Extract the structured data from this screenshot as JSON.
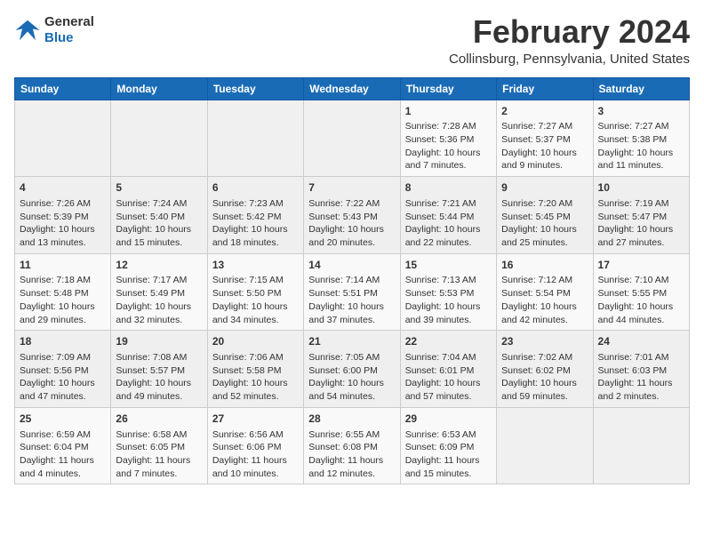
{
  "header": {
    "logo_line1": "General",
    "logo_line2": "Blue",
    "month_title": "February 2024",
    "location": "Collinsburg, Pennsylvania, United States"
  },
  "days_of_week": [
    "Sunday",
    "Monday",
    "Tuesday",
    "Wednesday",
    "Thursday",
    "Friday",
    "Saturday"
  ],
  "weeks": [
    [
      {
        "day": "",
        "content": ""
      },
      {
        "day": "",
        "content": ""
      },
      {
        "day": "",
        "content": ""
      },
      {
        "day": "",
        "content": ""
      },
      {
        "day": "1",
        "content": "Sunrise: 7:28 AM\nSunset: 5:36 PM\nDaylight: 10 hours\nand 7 minutes."
      },
      {
        "day": "2",
        "content": "Sunrise: 7:27 AM\nSunset: 5:37 PM\nDaylight: 10 hours\nand 9 minutes."
      },
      {
        "day": "3",
        "content": "Sunrise: 7:27 AM\nSunset: 5:38 PM\nDaylight: 10 hours\nand 11 minutes."
      }
    ],
    [
      {
        "day": "4",
        "content": "Sunrise: 7:26 AM\nSunset: 5:39 PM\nDaylight: 10 hours\nand 13 minutes."
      },
      {
        "day": "5",
        "content": "Sunrise: 7:24 AM\nSunset: 5:40 PM\nDaylight: 10 hours\nand 15 minutes."
      },
      {
        "day": "6",
        "content": "Sunrise: 7:23 AM\nSunset: 5:42 PM\nDaylight: 10 hours\nand 18 minutes."
      },
      {
        "day": "7",
        "content": "Sunrise: 7:22 AM\nSunset: 5:43 PM\nDaylight: 10 hours\nand 20 minutes."
      },
      {
        "day": "8",
        "content": "Sunrise: 7:21 AM\nSunset: 5:44 PM\nDaylight: 10 hours\nand 22 minutes."
      },
      {
        "day": "9",
        "content": "Sunrise: 7:20 AM\nSunset: 5:45 PM\nDaylight: 10 hours\nand 25 minutes."
      },
      {
        "day": "10",
        "content": "Sunrise: 7:19 AM\nSunset: 5:47 PM\nDaylight: 10 hours\nand 27 minutes."
      }
    ],
    [
      {
        "day": "11",
        "content": "Sunrise: 7:18 AM\nSunset: 5:48 PM\nDaylight: 10 hours\nand 29 minutes."
      },
      {
        "day": "12",
        "content": "Sunrise: 7:17 AM\nSunset: 5:49 PM\nDaylight: 10 hours\nand 32 minutes."
      },
      {
        "day": "13",
        "content": "Sunrise: 7:15 AM\nSunset: 5:50 PM\nDaylight: 10 hours\nand 34 minutes."
      },
      {
        "day": "14",
        "content": "Sunrise: 7:14 AM\nSunset: 5:51 PM\nDaylight: 10 hours\nand 37 minutes."
      },
      {
        "day": "15",
        "content": "Sunrise: 7:13 AM\nSunset: 5:53 PM\nDaylight: 10 hours\nand 39 minutes."
      },
      {
        "day": "16",
        "content": "Sunrise: 7:12 AM\nSunset: 5:54 PM\nDaylight: 10 hours\nand 42 minutes."
      },
      {
        "day": "17",
        "content": "Sunrise: 7:10 AM\nSunset: 5:55 PM\nDaylight: 10 hours\nand 44 minutes."
      }
    ],
    [
      {
        "day": "18",
        "content": "Sunrise: 7:09 AM\nSunset: 5:56 PM\nDaylight: 10 hours\nand 47 minutes."
      },
      {
        "day": "19",
        "content": "Sunrise: 7:08 AM\nSunset: 5:57 PM\nDaylight: 10 hours\nand 49 minutes."
      },
      {
        "day": "20",
        "content": "Sunrise: 7:06 AM\nSunset: 5:58 PM\nDaylight: 10 hours\nand 52 minutes."
      },
      {
        "day": "21",
        "content": "Sunrise: 7:05 AM\nSunset: 6:00 PM\nDaylight: 10 hours\nand 54 minutes."
      },
      {
        "day": "22",
        "content": "Sunrise: 7:04 AM\nSunset: 6:01 PM\nDaylight: 10 hours\nand 57 minutes."
      },
      {
        "day": "23",
        "content": "Sunrise: 7:02 AM\nSunset: 6:02 PM\nDaylight: 10 hours\nand 59 minutes."
      },
      {
        "day": "24",
        "content": "Sunrise: 7:01 AM\nSunset: 6:03 PM\nDaylight: 11 hours\nand 2 minutes."
      }
    ],
    [
      {
        "day": "25",
        "content": "Sunrise: 6:59 AM\nSunset: 6:04 PM\nDaylight: 11 hours\nand 4 minutes."
      },
      {
        "day": "26",
        "content": "Sunrise: 6:58 AM\nSunset: 6:05 PM\nDaylight: 11 hours\nand 7 minutes."
      },
      {
        "day": "27",
        "content": "Sunrise: 6:56 AM\nSunset: 6:06 PM\nDaylight: 11 hours\nand 10 minutes."
      },
      {
        "day": "28",
        "content": "Sunrise: 6:55 AM\nSunset: 6:08 PM\nDaylight: 11 hours\nand 12 minutes."
      },
      {
        "day": "29",
        "content": "Sunrise: 6:53 AM\nSunset: 6:09 PM\nDaylight: 11 hours\nand 15 minutes."
      },
      {
        "day": "",
        "content": ""
      },
      {
        "day": "",
        "content": ""
      }
    ]
  ]
}
